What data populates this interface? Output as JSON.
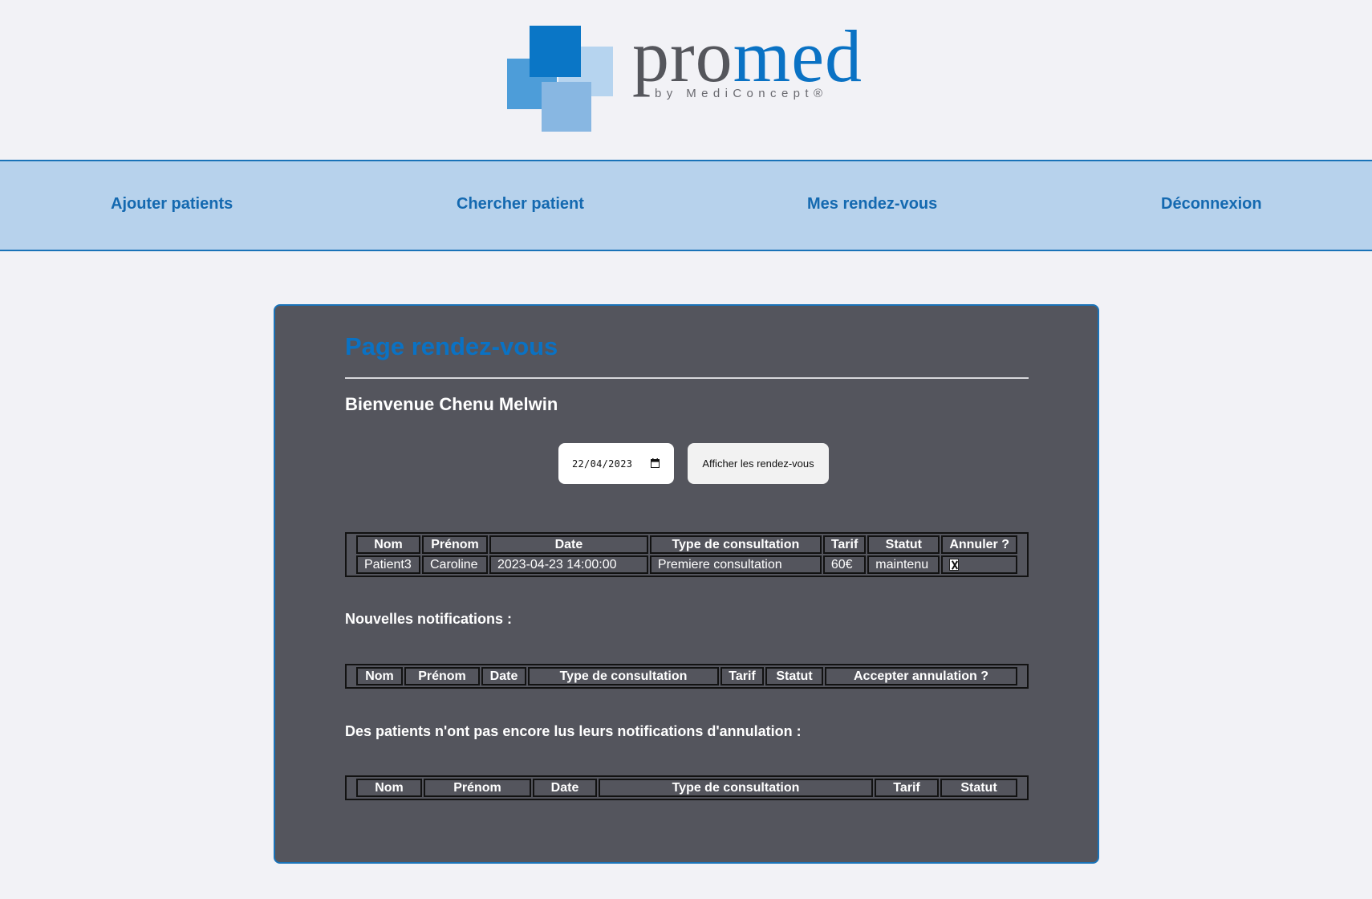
{
  "logo": {
    "word_main": "pro",
    "word_accent": "med",
    "tagline": "by MediConcept®",
    "colors": {
      "dark": "#55565c",
      "accent": "#0a72c4"
    }
  },
  "nav": {
    "items": [
      {
        "label": "Ajouter patients"
      },
      {
        "label": "Chercher patient"
      },
      {
        "label": "Mes rendez-vous"
      },
      {
        "label": "Déconnexion"
      }
    ]
  },
  "main": {
    "title": "Page rendez-vous",
    "welcome": "Bienvenue Chenu Melwin",
    "date_value": "22/04/2023",
    "show_button": "Afficher les rendez-vous",
    "appointments": {
      "headers": [
        "Nom",
        "Prénom",
        "Date",
        "Type de consultation",
        "Tarif",
        "Statut",
        "Annuler ?"
      ],
      "rows": [
        {
          "nom": "Patient3",
          "prenom": "Caroline",
          "date": "2023-04-23 14:00:00",
          "type": "Premiere consultation",
          "tarif": "60€",
          "statut": "maintenu",
          "annuler": true
        }
      ]
    },
    "notifications": {
      "label": "Nouvelles notifications :",
      "headers": [
        "Nom",
        "Prénom",
        "Date",
        "Type de consultation",
        "Tarif",
        "Statut",
        "Accepter annulation ?"
      ],
      "rows": []
    },
    "unread": {
      "label": "Des patients n'ont pas encore lus leurs notifications d'annulation :",
      "headers": [
        "Nom",
        "Prénom",
        "Date",
        "Type de consultation",
        "Tarif",
        "Statut"
      ],
      "rows": []
    }
  },
  "colors": {
    "background": "#f2f2f6",
    "nav_background": "#b7d2ec",
    "nav_text": "#1469b0",
    "panel": "#54555d",
    "title": "#0a72c4"
  }
}
